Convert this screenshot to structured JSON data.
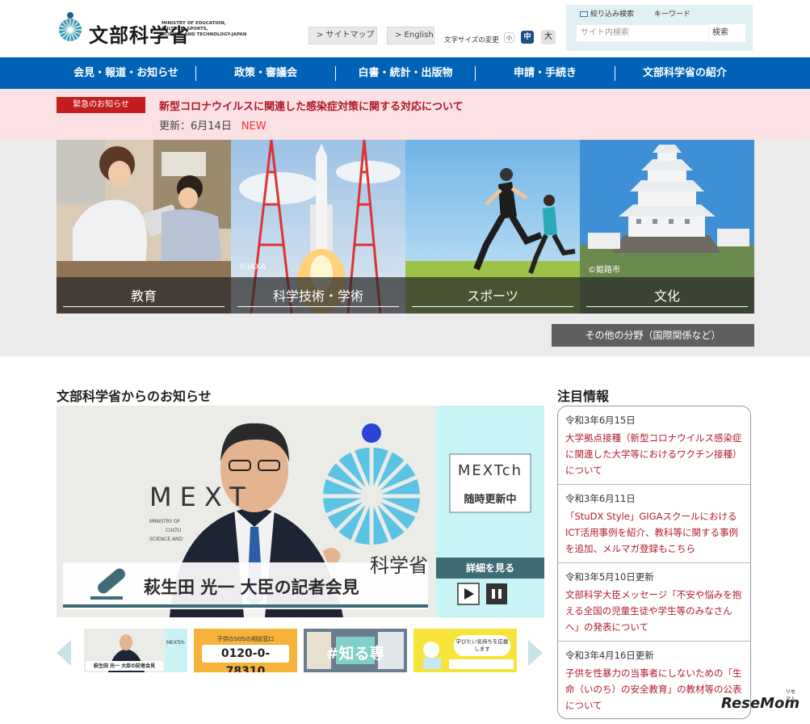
{
  "header": {
    "logo_ja": "文部科学省",
    "logo_en_lines": [
      "MINISTRY OF EDUCATION,",
      "CULTURE, SPORTS,",
      "SCIENCE AND TECHNOLOGY-JAPAN"
    ],
    "sitemap_label": "> サイトマップ",
    "english_label": "> English",
    "font_size_label": "文字サイズの変更",
    "font_sizes": [
      "小",
      "中",
      "大"
    ],
    "search": {
      "tab_filter": "絞り込み検索",
      "tab_keyword": "キーワード",
      "placeholder": "サイト内検索",
      "button": "検索"
    }
  },
  "nav": {
    "items": [
      "会見・報道・お知らせ",
      "政策・審議会",
      "白書・統計・出版物",
      "申請・手続き",
      "文部科学省の紹介"
    ]
  },
  "emergency": {
    "badge": "緊急のお知らせ",
    "title": "新型コロナウイルスに関連した感染症対策に関する対応について",
    "update": "更新：6月14日",
    "new_label": "NEW"
  },
  "hero": {
    "tiles": [
      {
        "label": "教育",
        "credit": ""
      },
      {
        "label": "科学技術・学術",
        "credit": "©JAXA"
      },
      {
        "label": "スポーツ",
        "credit": ""
      },
      {
        "label": "文化",
        "credit": "©姫路市"
      }
    ],
    "other_label": "その他の分野（国際関係など）"
  },
  "main": {
    "section_title": "文部科学省からのお知らせ",
    "banner": {
      "mext_text": "MEXT",
      "building_text": "科学省",
      "side_title": "MEXTch",
      "side_sub": "随時更新中",
      "details_label": "詳細を見る",
      "caption": "萩生田 光一 大臣の記者会見",
      "small_lines": [
        "MINISTRY OF",
        "CULTU",
        "SCIENCE AND"
      ]
    },
    "thumbnails": [
      {
        "title": "萩生田 光一 大臣の記者会見",
        "side": "MEXTch"
      },
      {
        "title": "0120-0-78310",
        "sub": "子供のSOSの相談窓口"
      },
      {
        "title": "#知る専",
        "sub": ""
      },
      {
        "title": "学びたい気持ちを応援します",
        "sub": ""
      }
    ]
  },
  "attention": {
    "section_title": "注目情報",
    "items": [
      {
        "date": "令和3年6月15日",
        "text": "大学拠点接種（新型コロナウイルス感染症に関連した大学等におけるワクチン接種）について"
      },
      {
        "date": "令和3年6月11日",
        "text": "「StuDX Style」GIGAスクールにおけるICT活用事例を紹介、教科等に関する事例を追加、メルマガ登録もこちら"
      },
      {
        "date": "令和3年5月10日更新",
        "text": "文部科学大臣メッセージ「不安や悩みを抱える全国の児童生徒や学生等のみなさんへ」の発表について"
      },
      {
        "date": "令和3年4月16日更新",
        "text": "子供を性暴力の当事者にしないための「生命（いのち）の安全教育」の教材等の公表について"
      }
    ]
  },
  "watermark": {
    "text": "ReseMom",
    "small": "リセマム"
  },
  "colors": {
    "nav": "#0062b6",
    "emergency_bg": "#fbe1e3",
    "emergency_badge": "#c41d1d",
    "link_red": "#b01c2e",
    "banner_cyan": "#c8f4f6"
  }
}
